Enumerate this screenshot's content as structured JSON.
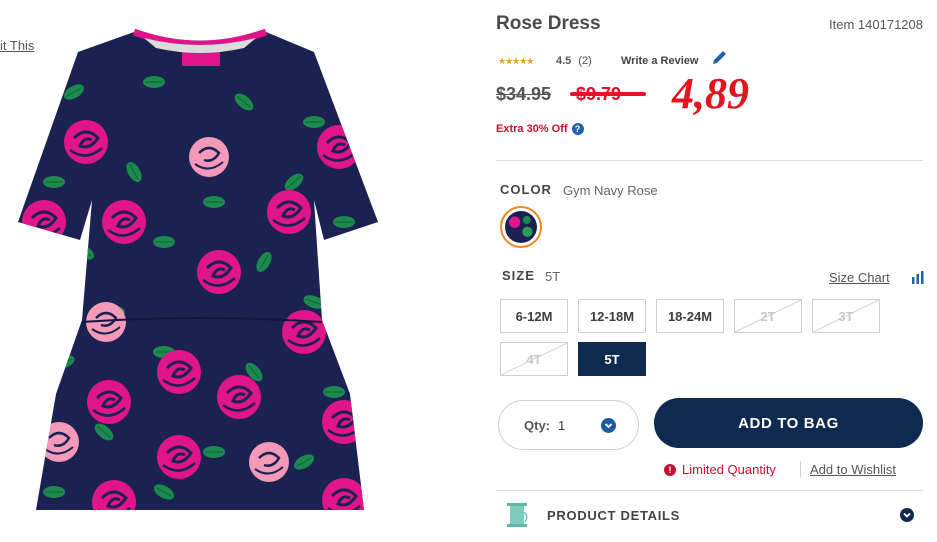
{
  "left": {
    "link_text": "it This"
  },
  "product": {
    "title": "Rose Dress",
    "item_number": "Item 140171208",
    "rating": {
      "stars": "★★★★★",
      "value": "4.5",
      "count": "(2)",
      "write_review": "Write a Review"
    },
    "price": {
      "original": "$34.95",
      "sale": "$9.79",
      "handwritten": "4,89"
    },
    "promo": {
      "text": "Extra 30% Off",
      "info_icon": "?"
    },
    "color": {
      "label": "COLOR",
      "value": "Gym Navy Rose"
    },
    "size": {
      "label": "SIZE",
      "value": "5T",
      "chart_link": "Size Chart",
      "options": [
        {
          "label": "6-12M",
          "state": "available"
        },
        {
          "label": "12-18M",
          "state": "available"
        },
        {
          "label": "18-24M",
          "state": "available"
        },
        {
          "label": "2T",
          "state": "unavailable"
        },
        {
          "label": "3T",
          "state": "unavailable"
        },
        {
          "label": "4T",
          "state": "unavailable"
        },
        {
          "label": "5T",
          "state": "selected"
        }
      ]
    },
    "quantity": {
      "label": "Qty:",
      "value": "1"
    },
    "add_to_bag": "ADD TO BAG",
    "limited_quantity": "Limited Quantity",
    "add_to_wishlist": "Add to Wishlist",
    "details": {
      "label": "PRODUCT DETAILS"
    }
  },
  "colors": {
    "navy": "#0f2a4f",
    "sale_red": "#d8102a",
    "accent_blue": "#1e62b0",
    "swatch_ring": "#f08a1c",
    "dress_navy": "#1b2151",
    "rose_pink": "#e0158a",
    "leaf_green": "#1b8a4c"
  },
  "icons": [
    "pencil-icon",
    "info-icon",
    "chart-icon",
    "chevron-down-icon",
    "alert-icon",
    "spool-icon"
  ]
}
